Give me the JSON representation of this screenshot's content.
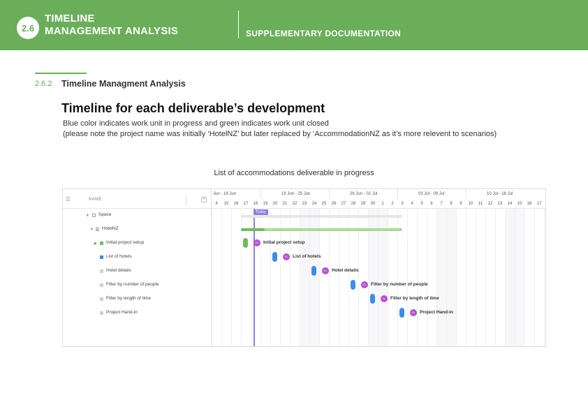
{
  "header": {
    "section_number": "2.6",
    "title_line1": "TIMELINE",
    "title_line2": "MANAGEMENT ANALYSIS",
    "subtitle": "SUPPLEMENTARY DOCUMENTATION",
    "color": "#6aae5a"
  },
  "subsection": {
    "number": "2.6.2",
    "title": "Timeline Managment Analysis"
  },
  "main": {
    "heading": "Timeline for each deliverable’s development",
    "desc1": "Blue color indicates work unit in progress and green indicates work unit closed",
    "desc2": "(please note the project name was initially ‘HotelNZ’ but later replaced by ‘AccommodationNZ as it’s more relevent to scenarios)",
    "caption": "List of accommodations deliverable in progress"
  },
  "gantt": {
    "name_column": "NAME",
    "today_label": "Today",
    "weeks": [
      "Jun - 18 Jun",
      "19 Jun - 25 Jun",
      "26 Jun - 02 Jul",
      "03 Jul - 09 Jul",
      "10 Jul - 16 Jul"
    ],
    "days": [
      "4",
      "15",
      "16",
      "17",
      "18",
      "19",
      "20",
      "21",
      "22",
      "23",
      "24",
      "25",
      "26",
      "27",
      "28",
      "29",
      "30",
      "1",
      "2",
      "3",
      "4",
      "5",
      "6",
      "7",
      "8",
      "9",
      "10",
      "11",
      "12",
      "13",
      "14",
      "15",
      "16",
      "17",
      "1"
    ],
    "rows": [
      {
        "label": "Space",
        "kind": "space"
      },
      {
        "label": "HotelNZ",
        "kind": "list"
      },
      {
        "label": "Initial project setup",
        "kind": "task",
        "status": "closed"
      },
      {
        "label": "List of hotels",
        "kind": "task",
        "status": "in progress"
      },
      {
        "label": "Hotel details",
        "kind": "task",
        "status": "open"
      },
      {
        "label": "Filter by number of people",
        "kind": "task",
        "status": "open"
      },
      {
        "label": "Filter by length of time",
        "kind": "task",
        "status": "open"
      },
      {
        "label": "Project Hand-in",
        "kind": "task",
        "status": "open"
      }
    ],
    "assignee_initials": "CL",
    "colors": {
      "closed": "#6cc05a",
      "in_progress": "#3b8de8",
      "today": "#8b7fe0",
      "assignee": "#b84fd0",
      "progress_light": "#a8dc96",
      "space_bar": "#e6e6e6"
    }
  }
}
